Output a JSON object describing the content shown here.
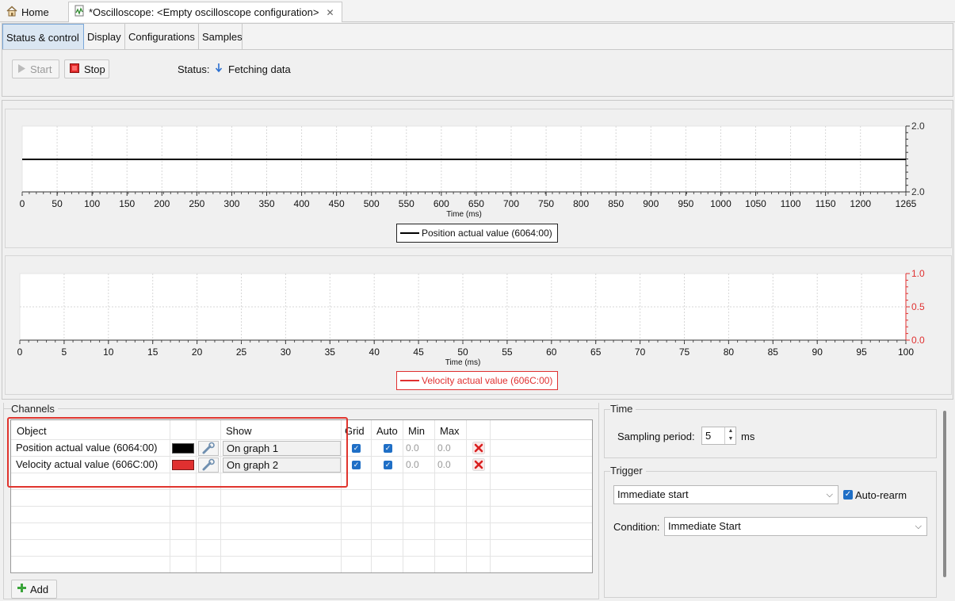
{
  "editor_tabs": {
    "home": "Home",
    "oscilloscope": "*Oscilloscope: <Empty oscilloscope configuration>"
  },
  "sub_tabs": [
    "Status & control",
    "Display",
    "Configurations",
    "Samples"
  ],
  "controls": {
    "start": "Start",
    "stop": "Stop",
    "status_label": "Status:",
    "status_value": "Fetching data"
  },
  "graph1": {
    "x_ticks": [
      "0",
      "50",
      "100",
      "150",
      "200",
      "250",
      "300",
      "350",
      "400",
      "450",
      "500",
      "550",
      "600",
      "650",
      "700",
      "750",
      "800",
      "850",
      "900",
      "950",
      "1000",
      "1050",
      "1100",
      "1150",
      "1200",
      "1265"
    ],
    "xlabel": "Time (ms)",
    "y_ticks": [
      "2.0",
      "2.0"
    ],
    "legend": "Position actual value (6064:00)",
    "color": "#000000"
  },
  "graph2": {
    "x_ticks": [
      "0",
      "5",
      "10",
      "15",
      "20",
      "25",
      "30",
      "35",
      "40",
      "45",
      "50",
      "55",
      "60",
      "65",
      "70",
      "75",
      "80",
      "85",
      "90",
      "95",
      "100"
    ],
    "xlabel": "Time (ms)",
    "y_ticks": [
      "1.0",
      "0.5",
      "0.0"
    ],
    "legend": "Velocity actual value (606C:00)",
    "color": "#e03030"
  },
  "chart_data": [
    {
      "type": "line",
      "xlabel": "Time (ms)",
      "xlim": [
        0,
        1265
      ],
      "ylim": [
        2.0,
        2.0
      ],
      "series": [
        {
          "name": "Position actual value (6064:00)",
          "x": [
            0,
            1265
          ],
          "y": [
            2.0,
            2.0
          ]
        }
      ],
      "legend": "bottom-center",
      "grid": true
    },
    {
      "type": "line",
      "xlabel": "Time (ms)",
      "xlim": [
        0,
        100
      ],
      "ylim": [
        0.0,
        1.0
      ],
      "series": [
        {
          "name": "Velocity actual value (606C:00)",
          "x": [],
          "y": []
        }
      ],
      "legend": "bottom-center",
      "grid": true
    }
  ],
  "channels": {
    "title": "Channels",
    "headers": {
      "object": "Object",
      "show": "Show",
      "grid": "Grid",
      "auto": "Auto",
      "min": "Min",
      "max": "Max"
    },
    "rows": [
      {
        "object": "Position actual value (6064:00)",
        "color": "#000000",
        "show": "On graph 1",
        "min": "0.0",
        "max": "0.0"
      },
      {
        "object": "Velocity actual value (606C:00)",
        "color": "#e03030",
        "show": "On graph 2",
        "min": "0.0",
        "max": "0.0"
      }
    ],
    "add": "Add"
  },
  "time": {
    "title": "Time",
    "sampling_label": "Sampling period:",
    "sampling_value": "5",
    "unit": "ms"
  },
  "trigger": {
    "title": "Trigger",
    "mode": "Immediate start",
    "auto_rearm": "Auto-rearm",
    "condition_label": "Condition:",
    "condition_value": "Immediate Start"
  }
}
